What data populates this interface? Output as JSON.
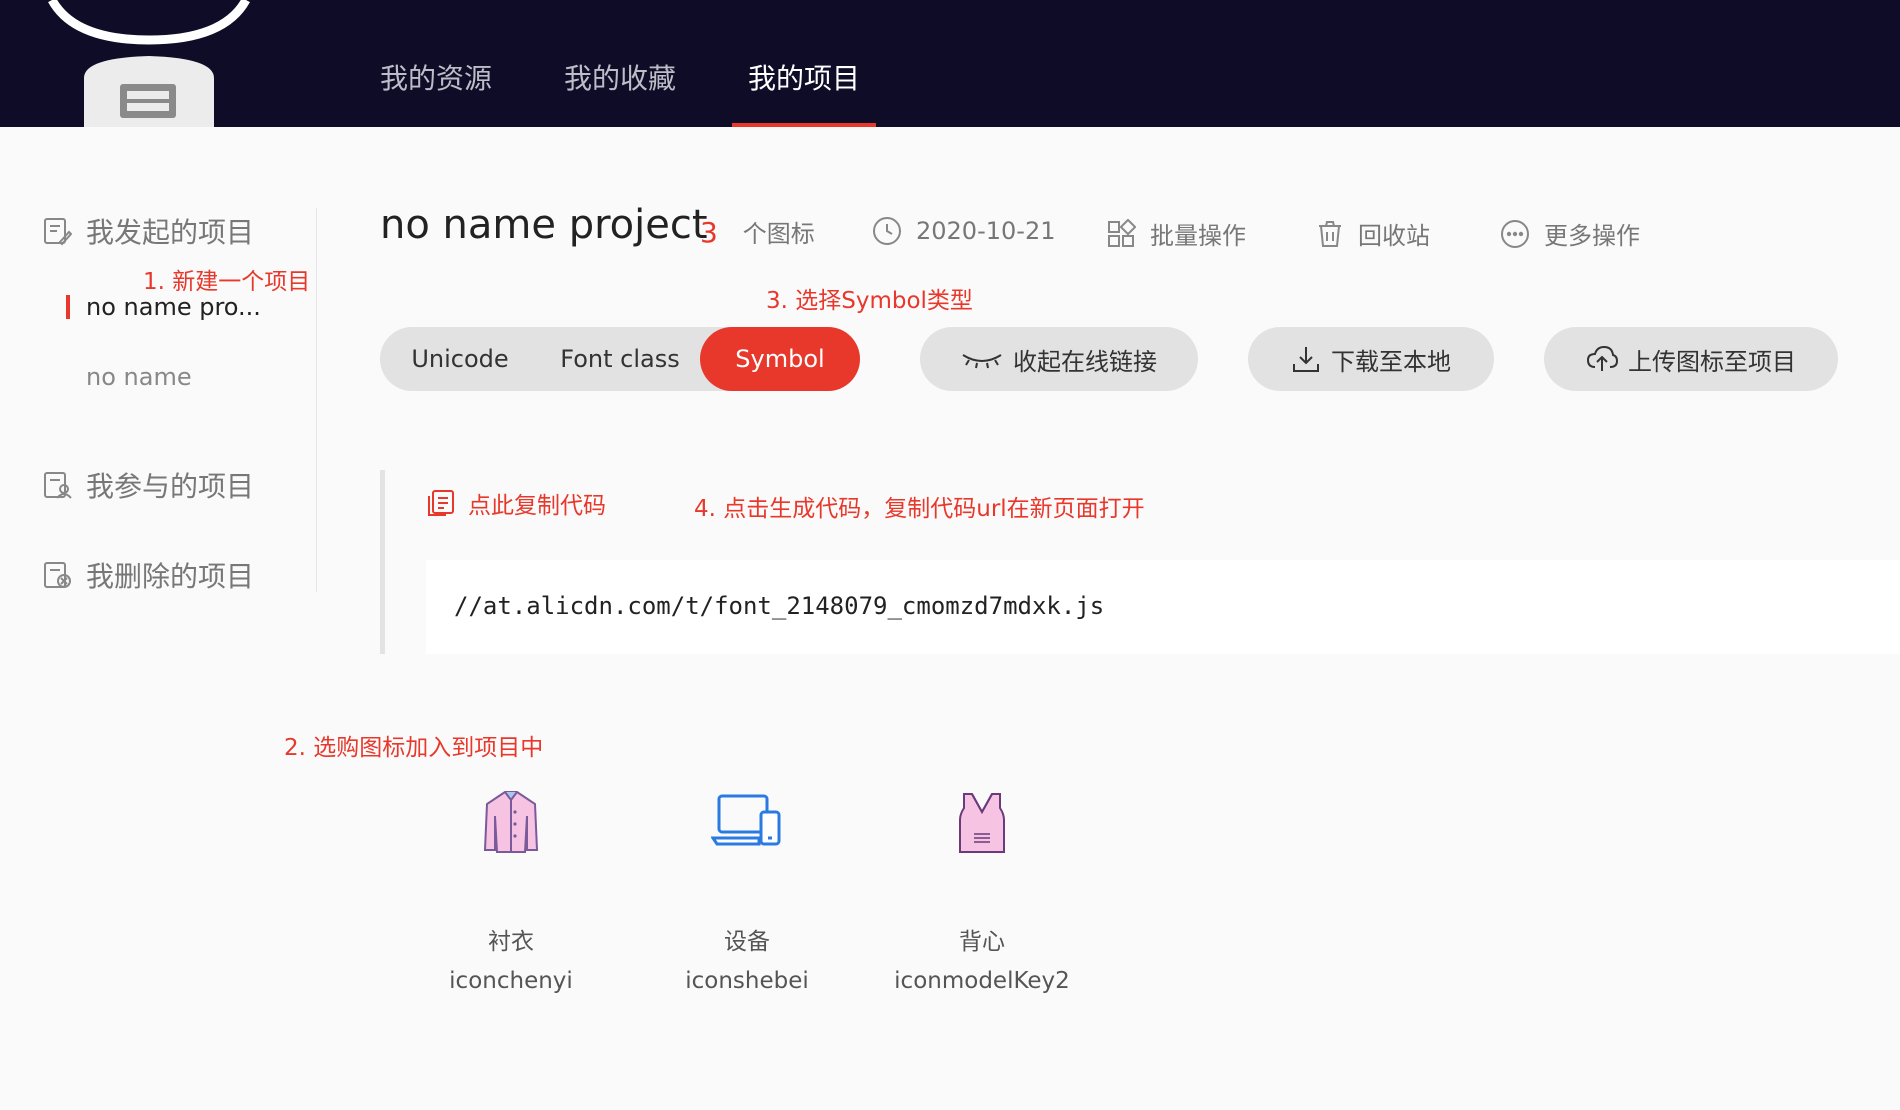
{
  "nav": {
    "items": [
      {
        "label": "我的资源"
      },
      {
        "label": "我的收藏"
      },
      {
        "label": "我的项目"
      }
    ],
    "active_index": 2
  },
  "sidebar": {
    "groups": [
      {
        "label": "我发起的项目",
        "icon": "project-edit-icon"
      },
      {
        "label": "我参与的项目",
        "icon": "project-user-icon"
      },
      {
        "label": "我删除的项目",
        "icon": "project-delete-icon"
      }
    ],
    "projects": [
      {
        "label": "no name pro..."
      },
      {
        "label": "no name"
      }
    ]
  },
  "annotations": {
    "step1": "1. 新建一个项目",
    "step2": "2. 选购图标加入到项目中",
    "step3": "3. 选择Symbol类型",
    "step4": "4. 点击生成代码，复制代码url在新页面打开"
  },
  "project": {
    "title": "no name project",
    "icon_count": "3",
    "icon_count_unit": "个图标",
    "date": "2020-10-21",
    "batch_label": "批量操作",
    "recycle_label": "回收站",
    "more_label": "更多操作"
  },
  "type_switch": {
    "options": [
      "Unicode",
      "Font class",
      "Symbol"
    ],
    "selected": "Symbol"
  },
  "actions": {
    "collapse_link": "收起在线链接",
    "download": "下载至本地",
    "upload": "上传图标至项目"
  },
  "code_panel": {
    "copy_label": "点此复制代码",
    "url": "//at.alicdn.com/t/font_2148079_cmomzd7mdxk.js"
  },
  "icons": [
    {
      "name": "衬衣",
      "code": "iconchenyi",
      "icon": "shirt-icon"
    },
    {
      "name": "设备",
      "code": "iconshebei",
      "icon": "device-icon"
    },
    {
      "name": "背心",
      "code": "iconmodelKey2",
      "icon": "vest-icon"
    }
  ],
  "colors": {
    "accent": "#e8382b",
    "nav_bg": "#0f0c28",
    "pill_bg": "#e2e2e2"
  }
}
